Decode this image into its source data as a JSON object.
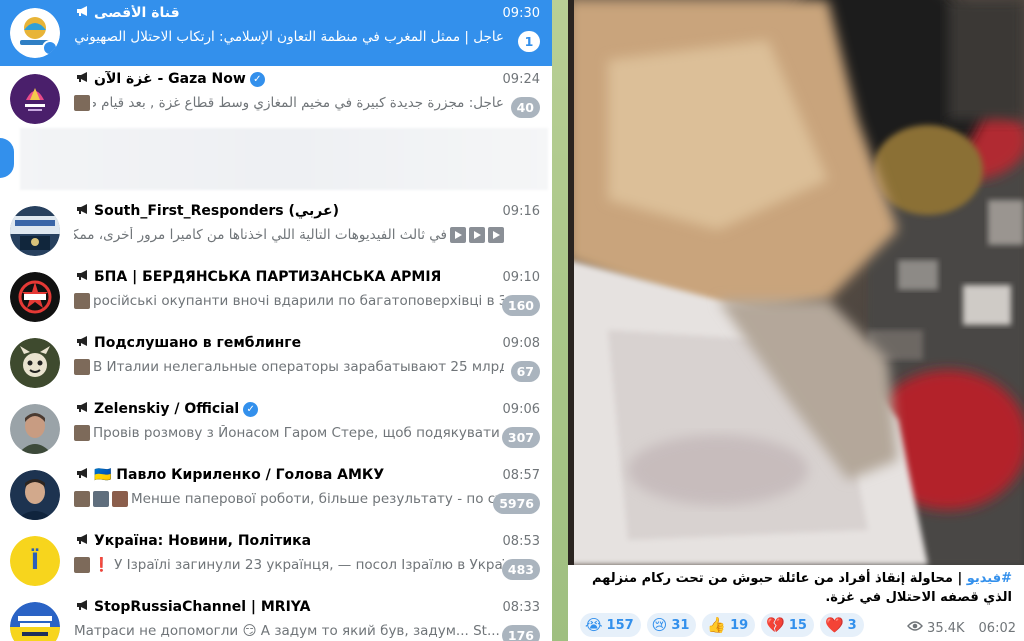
{
  "chats": [
    {
      "name": "channel-al-aqsa",
      "title": "قناة الأقصى",
      "time": "09:30",
      "preview": "عاجل | ممثل المغرب في منظمة التعاون الإسلامي: ارتكاب الاحتلال الصهيوني ل#...",
      "badge": "1",
      "active": true,
      "verified": false,
      "avatar": "al-aqsa-logo"
    },
    {
      "name": "channel-gaza-now",
      "title": "غزة الآن - Gaza Now",
      "time": "09:24",
      "preview": "عاجل: مجزرة جديدة كبيرة في مخيم المغازي وسط قطاع غزة , بعد قيام طائرا...",
      "badge": "40",
      "active": false,
      "verified": true,
      "avatar": "gaza-now-logo"
    },
    {
      "name": "channel-south-first-responders",
      "title": "South_First_Responders (عربي)",
      "time": "09:16",
      "preview": "في ثالث الفيديوهات التالية اللي اخذناها من كاميرا مرور أخرى، ممكن نرى...",
      "badge": "",
      "active": false,
      "verified": false,
      "avatar": "responders-photo"
    },
    {
      "name": "channel-bpa",
      "title": "БПА | БЕРДЯНСЬКА ПАРТИЗАНСЬКА АРМІЯ",
      "time": "09:10",
      "preview": "російські окупанти вночі вдарили по багатоповерхівці в За...",
      "badge": "160",
      "active": false,
      "verified": false,
      "avatar": "bpa-logo"
    },
    {
      "name": "channel-podslushano",
      "title": "Подслушано в гемблинге",
      "time": "09:08",
      "preview": "В Италии нелегальные операторы зарабатывают 25 млрд ев...",
      "badge": "67",
      "active": false,
      "verified": false,
      "avatar": "gambling-logo"
    },
    {
      "name": "channel-zelenskiy",
      "title": "Zelenskiy / Official",
      "time": "09:06",
      "preview": "Провів розмову з Йонасом Гаром Стере, щоб подякувати ...",
      "badge": "307",
      "active": false,
      "verified": true,
      "avatar": "zelenskiy-photo"
    },
    {
      "name": "channel-kyrylenko",
      "title": "🇺🇦 Павло Кириленко / Голова АМКУ",
      "time": "08:57",
      "preview": "Менше паперової роботи, більше результату - по су...",
      "badge": "5976",
      "active": false,
      "verified": false,
      "avatar": "kyrylenko-photo"
    },
    {
      "name": "channel-ukraina-novyny",
      "title": "Україна: Новини, Політика",
      "time": "08:53",
      "preview": "❗ У Ізраїлі загинули 23 українця, — посол Ізраїлю в Україні...",
      "badge": "483",
      "active": false,
      "verified": false,
      "avatar": "ukraina-logo"
    },
    {
      "name": "channel-stoprussia",
      "title": "StopRussiaChannel | MRIYA",
      "time": "08:33",
      "preview": "Матраси не допомогли 😏 А задум то який був, задум... St...",
      "badge": "176",
      "active": false,
      "verified": false,
      "avatar": "stoprussia-logo"
    }
  ],
  "post": {
    "hashtag": "#فيديو",
    "caption": " | محاولة إنقاذ أفراد من عائلة حبوش من تحت ركام منزلهم الذي قصفه الاحتلال في غزة.",
    "reactions": [
      {
        "emoji": "😭",
        "count": "157"
      },
      {
        "emoji": "😢",
        "count": "31"
      },
      {
        "emoji": "👍",
        "count": "19"
      },
      {
        "emoji": "💔",
        "count": "15"
      },
      {
        "emoji": "❤️",
        "count": "3"
      }
    ],
    "views": "35.4K",
    "time": "06:02"
  },
  "colors": {
    "accent": "#3390ec",
    "badge_muted": "#aab4be",
    "divider_green": "#a9c688"
  }
}
